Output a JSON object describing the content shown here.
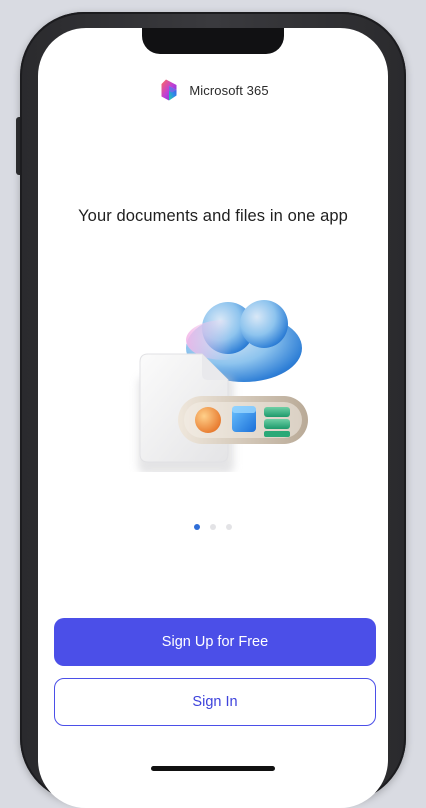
{
  "brand": {
    "name": "Microsoft 365",
    "logo_icon": "microsoft-365-logo"
  },
  "onboarding": {
    "headline": "Your documents and files in one app",
    "illustration_icon": "documents-cloud-illustration",
    "pagination": {
      "total": 3,
      "current": 1
    }
  },
  "actions": {
    "sign_up_label": "Sign Up for Free",
    "sign_in_label": "Sign In"
  },
  "colors": {
    "primary": "#4b4fe8",
    "active_dot": "#2f6ed8",
    "inactive_dot": "#e3e3e6"
  }
}
